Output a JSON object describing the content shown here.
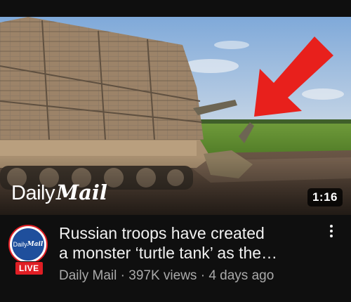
{
  "thumbnail": {
    "watermark_light": "Daily",
    "watermark_bold": "Mail",
    "duration": "1:16",
    "arrow_color": "#e8201c"
  },
  "channel": {
    "avatar_text_light": "Daily",
    "avatar_text_bold": "Mail",
    "live_label": "LIVE",
    "ring_color": "#e01e24"
  },
  "video": {
    "title_line1": "Russian troops have created",
    "title_line2": "a monster ‘turtle tank’ as the…",
    "channel_name": "Daily Mail",
    "separator": " · ",
    "views": "397K views",
    "age": "4 days ago"
  },
  "icons": {
    "menu": "more-vert-icon",
    "arrow": "arrow-annotation-icon"
  },
  "colors": {
    "background": "#0f0f0f",
    "title": "#f1f1f1",
    "secondary": "#aaaaaa",
    "live": "#e01e24"
  }
}
